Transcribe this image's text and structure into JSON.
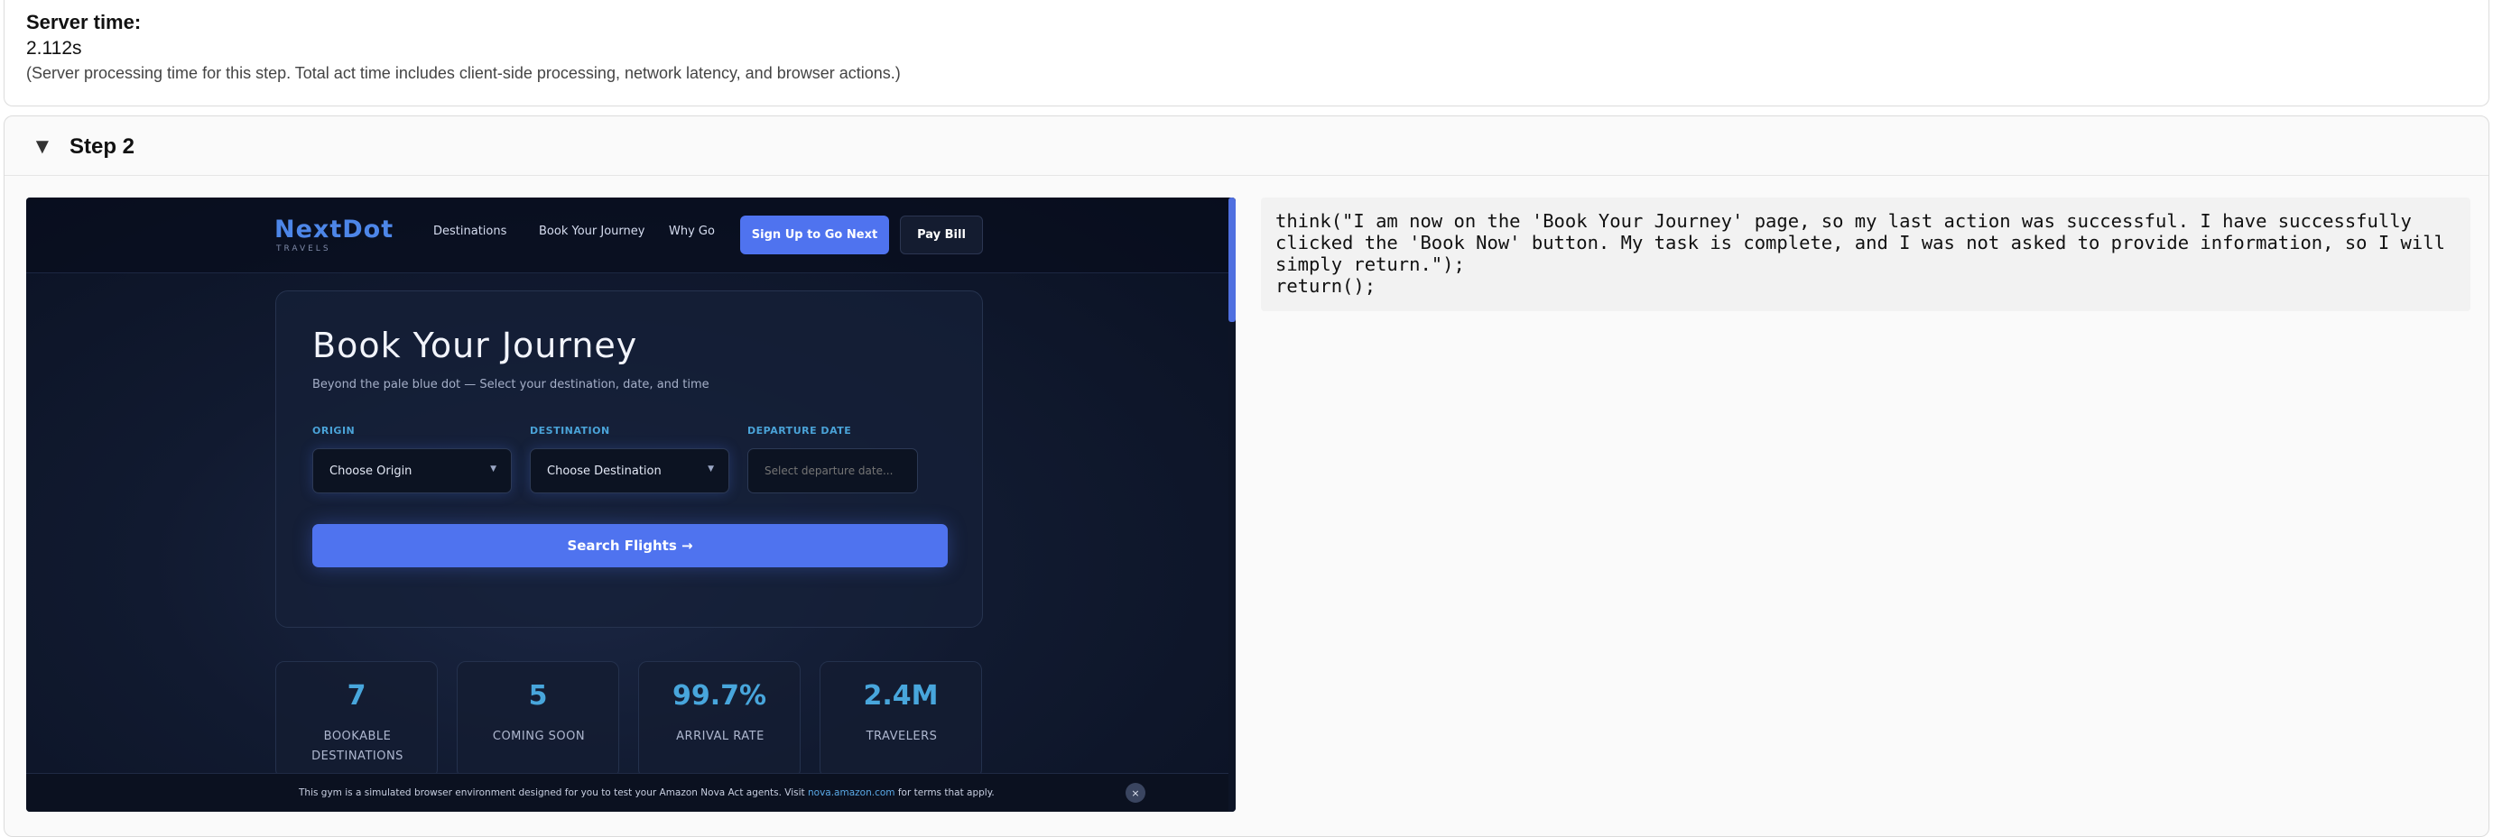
{
  "server": {
    "label": "Server time:",
    "value": "2.112s",
    "note": "(Server processing time for this step. Total act time includes client-side processing, network latency, and browser actions.)"
  },
  "step": {
    "caret": "▼",
    "title": "Step 2"
  },
  "screenshot": {
    "logo": "NextDot",
    "logo_sub": "TRAVELS",
    "nav": [
      "Destinations",
      "Book Your Journey",
      "Why Go"
    ],
    "signup_button": "Sign Up to Go Next",
    "paybill_button": "Pay Bill",
    "heading": "Book Your Journey",
    "subheading": "Beyond the pale blue dot — Select your destination, date, and time",
    "origin_label": "ORIGIN",
    "origin_value": "Choose Origin",
    "destination_label": "DESTINATION",
    "destination_value": "Choose Destination",
    "date_label": "DEPARTURE DATE",
    "date_placeholder": "Select departure date...",
    "search_button": "Search Flights →",
    "stats": [
      {
        "value": "7",
        "label": "BOOKABLE DESTINATIONS"
      },
      {
        "value": "5",
        "label": "COMING SOON"
      },
      {
        "value": "99.7%",
        "label": "ARRIVAL RATE"
      },
      {
        "value": "2.4M",
        "label": "TRAVELERS"
      }
    ],
    "banner_text_before": "This gym is a simulated browser environment designed for you to test your Amazon Nova Act agents. Visit ",
    "banner_link": "nova.amazon.com",
    "banner_text_after": " for terms that apply.",
    "banner_close": "×"
  },
  "code": "think(\"I am now on the 'Book Your Journey' page, so my last action was successful. I have successfully clicked the 'Book Now' button. My task is complete, and I was not asked to provide information, so I will simply return.\");\nreturn();"
}
